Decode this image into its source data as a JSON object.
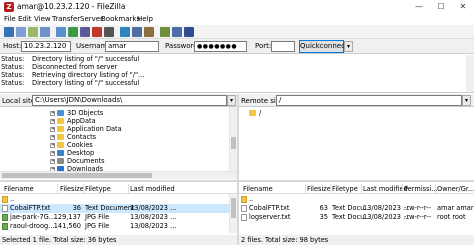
{
  "window": {
    "title": "amar@10.23.2.120 - FileZilla",
    "app_icon_letter": "Z",
    "controls": {
      "minimize": "—",
      "maximize": "☐",
      "close": "✕"
    }
  },
  "menu": [
    "File",
    "Edit",
    "View",
    "Transfer",
    "Server",
    "Bookmarks",
    "Help"
  ],
  "toolbar": {
    "buttons": [
      {
        "name": "site-manager",
        "color": "#3b6fb6"
      },
      {
        "name": "toggle-log",
        "color": "#7e9ecf"
      },
      {
        "name": "toggle-local-tree",
        "color": "#9ab76a"
      },
      {
        "name": "toggle-remote-tree",
        "color": "#6f8fc7"
      },
      {
        "name": "toggle-queue",
        "color": "#5a8fd0"
      },
      {
        "name": "refresh",
        "color": "#3a9a4a"
      },
      {
        "name": "process-queue",
        "color": "#5b5b9c"
      },
      {
        "name": "cancel",
        "color": "#c0392b"
      },
      {
        "name": "disconnect",
        "color": "#555555"
      },
      {
        "name": "reconnect",
        "color": "#2e86c1"
      },
      {
        "name": "directory-compare",
        "color": "#4f6f9f"
      },
      {
        "name": "sync-browse",
        "color": "#8e6f3e"
      },
      {
        "name": "filter",
        "color": "#6d8f3d"
      },
      {
        "name": "search",
        "color": "#4a6ea8"
      },
      {
        "name": "find",
        "color": "#2f4f8f"
      }
    ]
  },
  "quickconnect": {
    "host_label": "Host:",
    "host_value": "10.23.2.120",
    "username_label": "Username:",
    "username_value": "amar",
    "password_label": "Password:",
    "password_value": "●●●●●●●",
    "port_label": "Port:",
    "port_value": "",
    "button_label": "Quickconnect",
    "dropdown_glyph": "▾"
  },
  "log": [
    {
      "key": "Status:",
      "text": "Directory listing of \"/\" successful"
    },
    {
      "key": "Status:",
      "text": "Disconnected from server"
    },
    {
      "key": "Status:",
      "text": "Retrieving directory listing of \"/\"..."
    },
    {
      "key": "Status:",
      "text": "Directory listing of \"/\" successful"
    }
  ],
  "local": {
    "site_label": "Local site:",
    "path": "C:\\Users\\JDN\\Downloads\\",
    "tree": [
      {
        "label": "3D Objects",
        "icon_color": "#4a90d9"
      },
      {
        "label": "AppData",
        "icon_color": "#f4c542"
      },
      {
        "label": "Application Data",
        "icon_color": "#f4c542"
      },
      {
        "label": "Contacts",
        "icon_color": "#f4c542"
      },
      {
        "label": "Cookies",
        "icon_color": "#f4c542"
      },
      {
        "label": "Desktop",
        "icon_color": "#3b82c4"
      },
      {
        "label": "Documents",
        "icon_color": "#8a8a8a"
      },
      {
        "label": "Downloads",
        "icon_color": "#2a72c9"
      }
    ],
    "columns": {
      "name": "Filename",
      "size": "Filesize",
      "type": "Filetype",
      "modified": "Last modified"
    },
    "files": [
      {
        "name": "..",
        "size": "",
        "type": "",
        "modified": "",
        "kind": "folder"
      },
      {
        "name": "CobalFTP.txt",
        "size": "36",
        "type": "Text Document",
        "modified": "13/08/2023 ...",
        "kind": "txt",
        "selected": true
      },
      {
        "name": "jae-park-7G...",
        "size": "129,137",
        "type": "JPG File",
        "modified": "13/08/2023 ...",
        "kind": "img"
      },
      {
        "name": "raoul-droog...",
        "size": "141,560",
        "type": "JPG File",
        "modified": "13/08/2023 ...",
        "kind": "img"
      }
    ],
    "status": "Selected 1 file. Total size: 36 bytes"
  },
  "remote": {
    "site_label": "Remote site:",
    "path": "/",
    "tree": [
      {
        "label": "/",
        "icon_color": "#f4c542"
      }
    ],
    "columns": {
      "name": "Filename",
      "size": "Filesize",
      "type": "Filetype",
      "modified": "Last modified",
      "perms": "Permissi...",
      "owner": "Owner/Gr..."
    },
    "files": [
      {
        "name": "..",
        "size": "",
        "type": "",
        "modified": "",
        "perms": "",
        "owner": "",
        "kind": "folder"
      },
      {
        "name": "CobalFTP.txt",
        "size": "63",
        "type": "Text Docu...",
        "modified": "13/08/2023 ...",
        "perms": "-rw-r--r--",
        "owner": "amar amar",
        "kind": "txt"
      },
      {
        "name": "logserver.txt",
        "size": "35",
        "type": "Text Docu...",
        "modified": "13/08/2023 ...",
        "perms": "-rw-r--r--",
        "owner": "root root",
        "kind": "txt"
      }
    ],
    "status": "2 files. Total size: 98 bytes"
  }
}
